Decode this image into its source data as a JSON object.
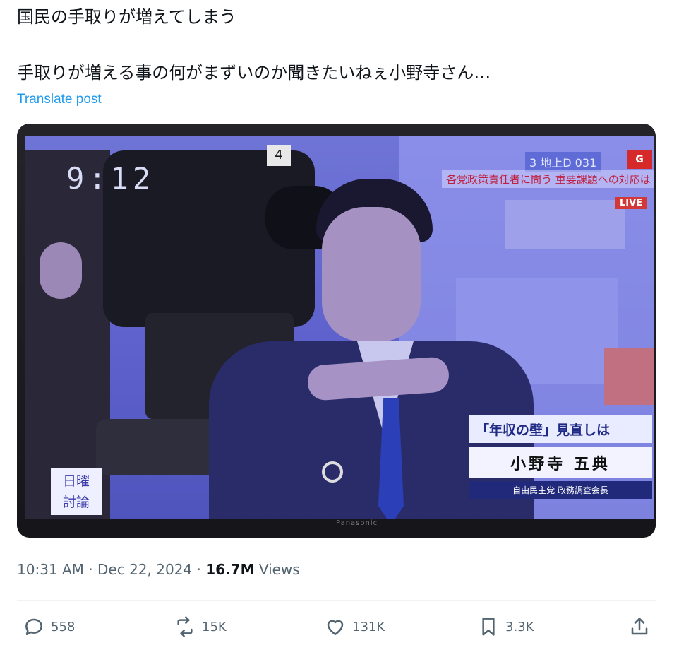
{
  "post": {
    "line1": "国民の手取りが増えてしまう",
    "line2": "手取りが増える事の何がまずいのか聞きたいねぇ小野寺さん…",
    "translate": "Translate post"
  },
  "photo": {
    "clock": "9:12",
    "camera_number": "4",
    "channel": "3 地上D 031",
    "brand": "G",
    "ticker": "各党政策責任者に問う 重要課題への対応は",
    "live": "LIVE",
    "show_logo_line1": "日曜",
    "show_logo_line2": "討論",
    "caption_topic": "「年収の壁」見直しは",
    "caption_name": "小野寺 五典",
    "caption_title": "自由民主党 政務調査会長",
    "tv_brand": "Panasonic"
  },
  "meta": {
    "time": "10:31 AM",
    "date": "Dec 22, 2024",
    "views_count": "16.7M",
    "views_label": "Views"
  },
  "actions": {
    "reply_count": "558",
    "repost_count": "15K",
    "like_count": "131K",
    "bookmark_count": "3.3K"
  },
  "colors": {
    "link": "#1d9bf0",
    "secondary_text": "#536471",
    "primary_text": "#0f1419"
  }
}
